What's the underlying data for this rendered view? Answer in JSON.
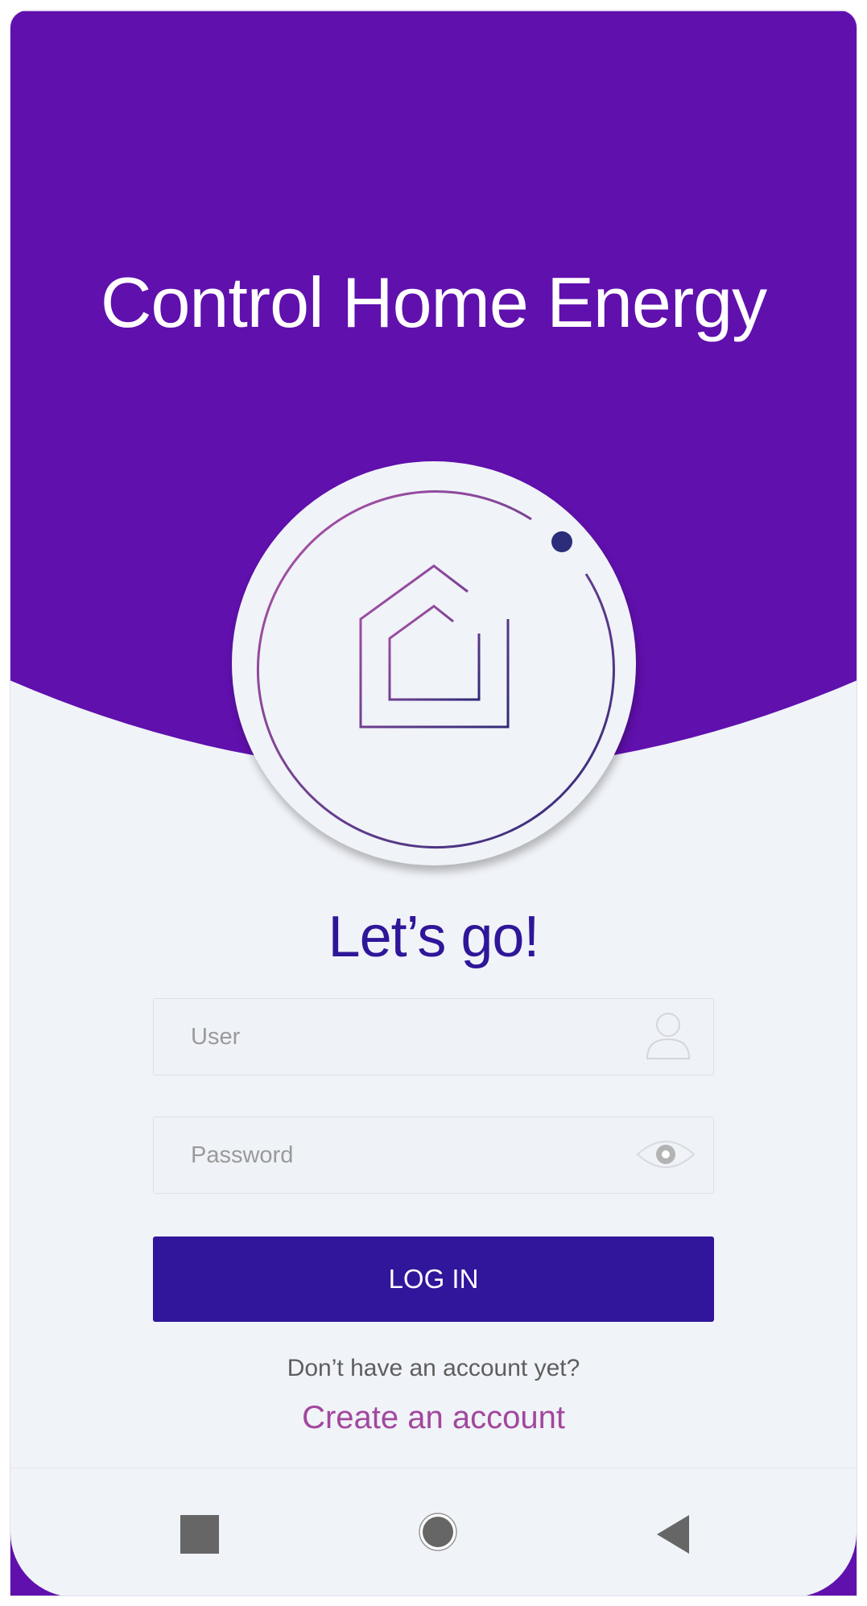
{
  "app": {
    "title": "Control Home Energy",
    "greeting": "Let’s go!"
  },
  "form": {
    "user_placeholder": "User",
    "password_placeholder": "Password",
    "login_label": "LOG IN",
    "signup_prompt": "Don’t have an account yet?",
    "signup_link": "Create an account"
  },
  "icons": {
    "logo": "house-in-ring-icon",
    "user": "user-icon",
    "password_toggle": "eye-icon",
    "nav_recents": "square-icon",
    "nav_home": "circle-icon",
    "nav_back": "triangle-back-icon"
  },
  "colors": {
    "header": "#6010ad",
    "background": "#f0f3f8",
    "greeting": "#2f1699",
    "button": "#31159b",
    "link": "#a2479d"
  }
}
